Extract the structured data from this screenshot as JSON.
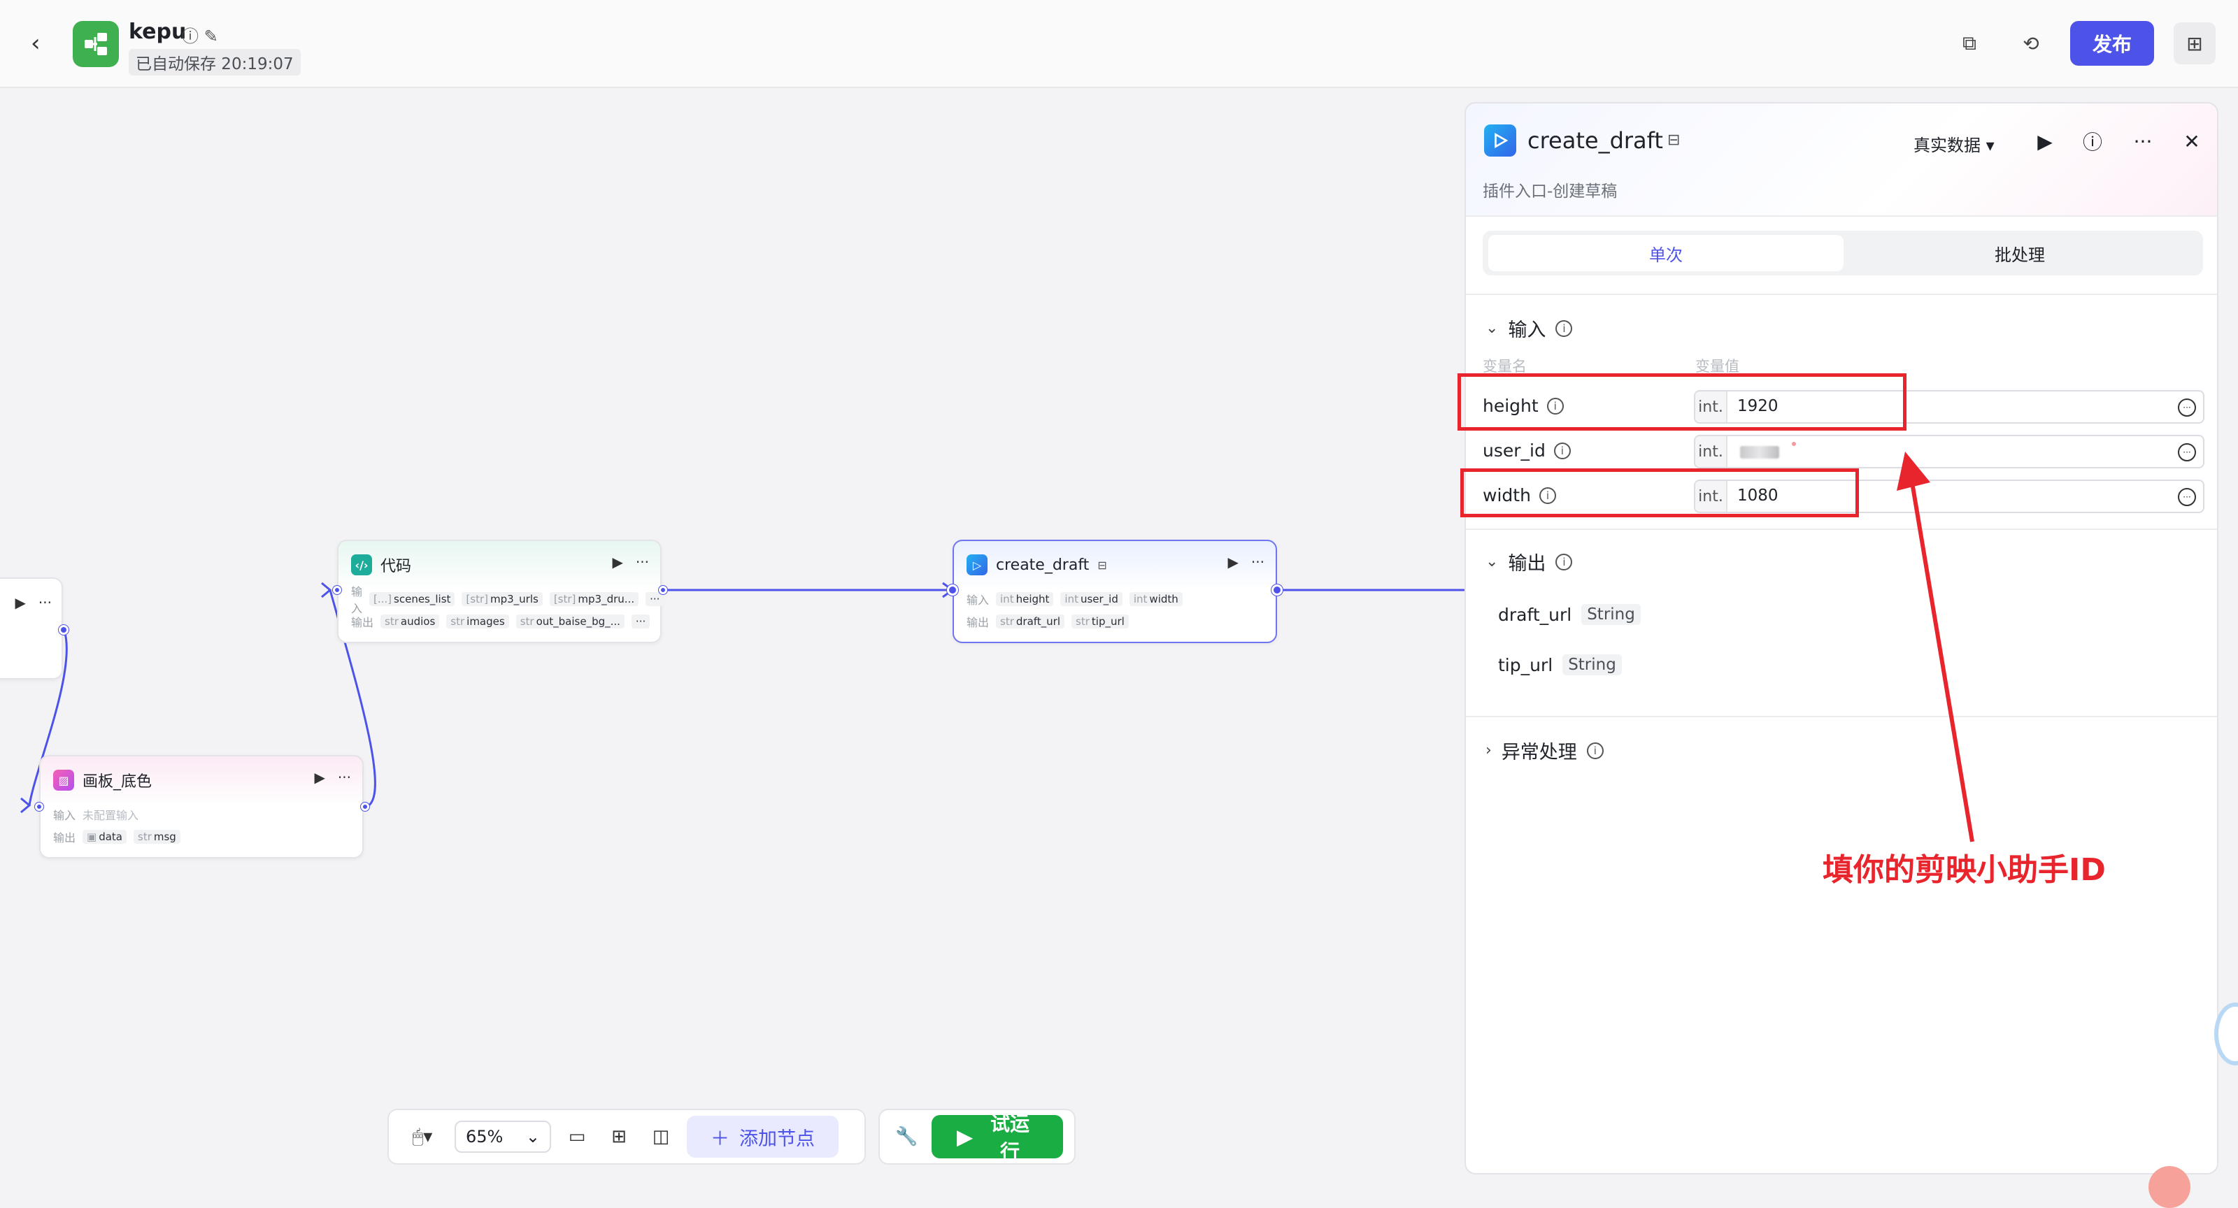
{
  "header": {
    "app_name": "kepu",
    "autosave": "已自动保存 20:19:07",
    "publish_label": "发布"
  },
  "canvas": {
    "nodes": {
      "code": {
        "title": "代码",
        "input_label": "输入",
        "output_label": "输出",
        "inputs": [
          {
            "type": "[...]",
            "name": "scenes_list"
          },
          {
            "type": "[str]",
            "name": "mp3_urls"
          },
          {
            "type": "[str]",
            "name": "mp3_dru..."
          }
        ],
        "outputs": [
          {
            "type": "str",
            "name": "audios"
          },
          {
            "type": "str",
            "name": "images"
          },
          {
            "type": "str",
            "name": "out_baise_bg_..."
          }
        ]
      },
      "create_draft": {
        "title": "create_draft",
        "input_label": "输入",
        "output_label": "输出",
        "inputs": [
          {
            "type": "int",
            "name": "height"
          },
          {
            "type": "int",
            "name": "user_id"
          },
          {
            "type": "int",
            "name": "width"
          }
        ],
        "outputs": [
          {
            "type": "str",
            "name": "draft_url"
          },
          {
            "type": "str",
            "name": "tip_url"
          }
        ]
      },
      "canvas_bg": {
        "title": "画板_底色",
        "input_label": "输入",
        "input_empty": "未配置输入",
        "output_label": "输出",
        "outputs": [
          {
            "type": "▣",
            "name": "data"
          },
          {
            "type": "str",
            "name": "msg"
          }
        ]
      }
    }
  },
  "bottom_toolbar": {
    "zoom": "65%",
    "add_node_label": "添加节点",
    "test_run_label": "试运行"
  },
  "panel": {
    "title": "create_draft",
    "subtitle": "插件入口-创建草稿",
    "data_mode": "真实数据",
    "tabs": [
      {
        "label": "单次",
        "active": true
      },
      {
        "label": "批处理",
        "active": false
      }
    ],
    "input_section": {
      "title": "输入",
      "col_name": "变量名",
      "col_value": "变量值",
      "fields": [
        {
          "name": "height",
          "type": "int.",
          "value": "1920"
        },
        {
          "name": "user_id",
          "type": "int.",
          "value": ""
        },
        {
          "name": "width",
          "type": "int.",
          "value": "1080"
        }
      ]
    },
    "output_section": {
      "title": "输出",
      "fields": [
        {
          "name": "draft_url",
          "type": "String"
        },
        {
          "name": "tip_url",
          "type": "String"
        }
      ]
    },
    "error_section": {
      "title": "异常处理"
    }
  },
  "annotation": {
    "text": "填你的剪映小助手ID",
    "color": "#e8242c"
  },
  "colors": {
    "accent": "#4d53e8",
    "run_green": "#1aad44"
  }
}
